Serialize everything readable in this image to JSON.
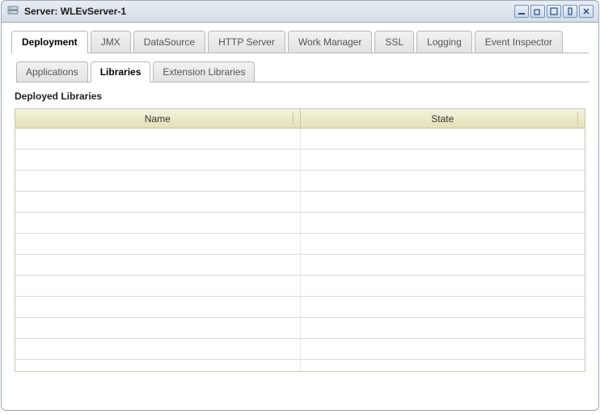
{
  "window": {
    "title": "Server: WLEvServer-1"
  },
  "tabs": {
    "items": [
      {
        "label": "Deployment",
        "active": true
      },
      {
        "label": "JMX"
      },
      {
        "label": "DataSource"
      },
      {
        "label": "HTTP Server"
      },
      {
        "label": "Work Manager"
      },
      {
        "label": "SSL"
      },
      {
        "label": "Logging"
      },
      {
        "label": "Event Inspector"
      }
    ]
  },
  "subtabs": {
    "items": [
      {
        "label": "Applications"
      },
      {
        "label": "Libraries",
        "active": true
      },
      {
        "label": "Extension Libraries"
      }
    ]
  },
  "section": {
    "title": "Deployed Libraries"
  },
  "table": {
    "columns": [
      "Name",
      "State"
    ],
    "rows": [
      {
        "name": "",
        "state": ""
      },
      {
        "name": "",
        "state": ""
      },
      {
        "name": "",
        "state": ""
      },
      {
        "name": "",
        "state": ""
      },
      {
        "name": "",
        "state": ""
      },
      {
        "name": "",
        "state": ""
      },
      {
        "name": "",
        "state": ""
      },
      {
        "name": "",
        "state": ""
      },
      {
        "name": "",
        "state": ""
      },
      {
        "name": "",
        "state": ""
      },
      {
        "name": "",
        "state": ""
      }
    ]
  }
}
